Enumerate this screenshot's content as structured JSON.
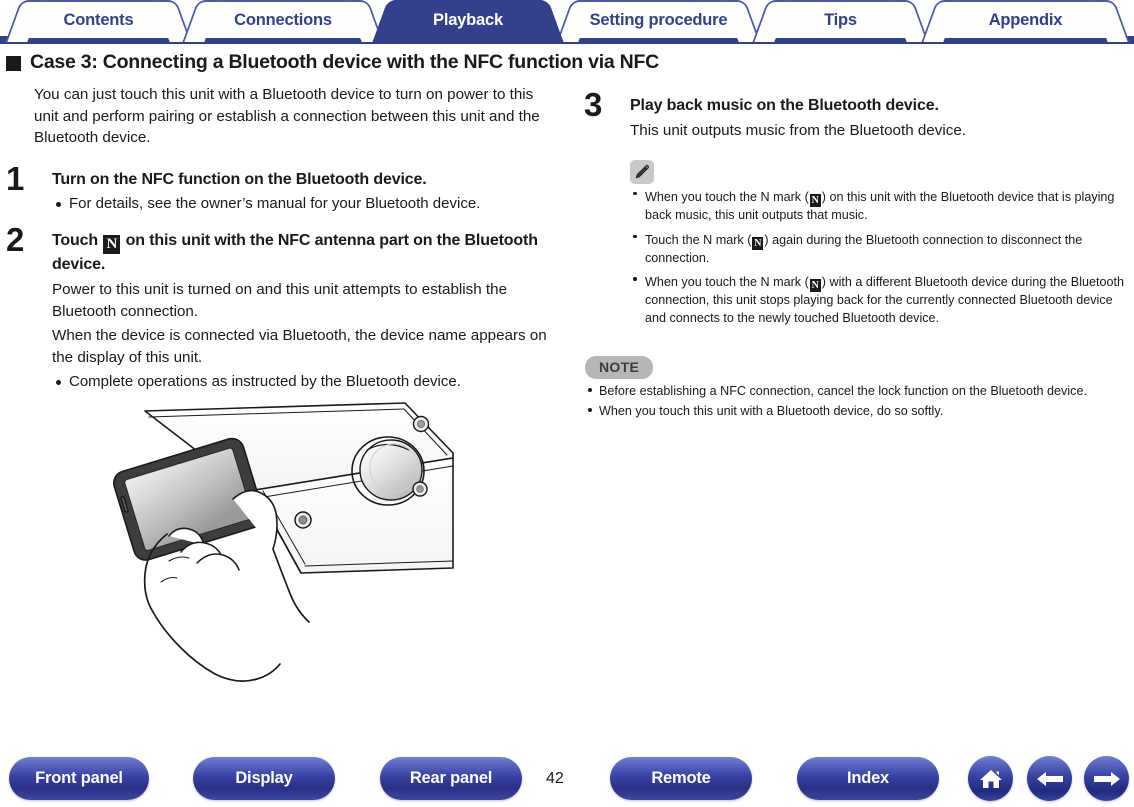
{
  "tabs": [
    {
      "label": "Contents",
      "active": false
    },
    {
      "label": "Connections",
      "active": false
    },
    {
      "label": "Playback",
      "active": true
    },
    {
      "label": "Setting procedure",
      "active": false
    },
    {
      "label": "Tips",
      "active": false
    },
    {
      "label": "Appendix",
      "active": false
    }
  ],
  "heading": {
    "text": "Case 3: Connecting a Bluetooth device with the NFC function via NFC"
  },
  "left_column": {
    "intro": "You can just touch this unit with a Bluetooth device to turn on power to this unit and perform pairing or establish a connection between this unit and the Bluetooth device.",
    "steps": [
      {
        "number": "1",
        "title": "Turn on the NFC function on the Bluetooth device.",
        "bullets": [
          "For details, see the owner’s manual for your Bluetooth device."
        ]
      },
      {
        "number": "2",
        "title_pre": "Touch",
        "title_post": "on this unit with the NFC antenna part on the Bluetooth device.",
        "paragraphs": [
          "Power to this unit is turned on and this unit attempts to establish the Bluetooth connection.",
          "When the device is connected via Bluetooth, the device name appears on the display of this unit."
        ],
        "bullets": [
          "Complete operations as instructed by the Bluetooth device."
        ]
      }
    ],
    "illustration_name": "hand-holding-phone-touching-unit-front-panel"
  },
  "right_column": {
    "step": {
      "number": "3",
      "title": "Play back music on the Bluetooth device.",
      "paragraph": "This unit outputs music from the Bluetooth device."
    },
    "tip_icon": "pencil-icon",
    "tips": [
      {
        "pre": "When you touch the N mark (",
        "post": ") on this unit with the Bluetooth device that is playing back music, this unit outputs that music."
      },
      {
        "pre": "Touch the N mark (",
        "post": ") again during the Bluetooth connection to disconnect the connection."
      },
      {
        "pre": "When you touch the N mark (",
        "post": ") with a different Bluetooth device during the Bluetooth connection, this unit stops playing back for the currently connected Bluetooth device and connects to the newly touched Bluetooth device."
      }
    ],
    "note": {
      "badge": "NOTE",
      "items": [
        "Before establishing a NFC connection, cancel the lock function on the Bluetooth device.",
        "When you touch this unit with a Bluetooth device, do so softly."
      ]
    }
  },
  "footer": {
    "buttons": [
      {
        "label": "Front panel"
      },
      {
        "label": "Display"
      },
      {
        "label": "Rear panel"
      },
      {
        "label": "Remote"
      },
      {
        "label": "Index"
      }
    ],
    "page_number": "42",
    "icons": [
      {
        "name": "home-icon"
      },
      {
        "name": "arrow-left-icon"
      },
      {
        "name": "arrow-right-icon"
      }
    ]
  },
  "colors": {
    "tab_active_bg": "#33408c",
    "tab_text": "#33408c",
    "rule": "#33408c",
    "note_badge_bg": "#b6b6b6",
    "pencil_badge_bg": "#c9c9c9"
  }
}
